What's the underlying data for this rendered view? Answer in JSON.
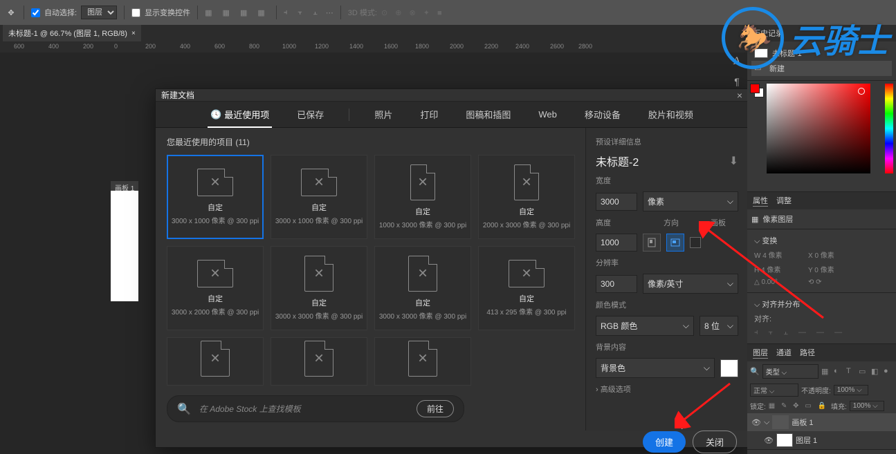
{
  "toolbar": {
    "auto_select": "自动选择:",
    "layer_dropdown": "图层",
    "show_transform": "显示变换控件",
    "mode_3d": "3D 模式:"
  },
  "doc_tab": {
    "title": "未标题-1 @ 66.7% (图层 1, RGB/8)"
  },
  "ruler_marks": [
    "600",
    "400",
    "200",
    "0",
    "200",
    "400",
    "600",
    "800",
    "1000",
    "1200",
    "1400",
    "1600",
    "1800",
    "2000",
    "2200",
    "2400",
    "2600",
    "2800"
  ],
  "artboard_label": "画板 1",
  "dialog": {
    "title": "新建文档",
    "tabs": {
      "recent": "最近使用项",
      "saved": "已保存",
      "photo": "照片",
      "print": "打印",
      "art": "图稿和插图",
      "web": "Web",
      "mobile": "移动设备",
      "film": "胶片和视频"
    },
    "recent_label": "您最近使用的项目 (11)",
    "presets": [
      {
        "name": "自定",
        "dim": "3000 x 1000 像素 @ 300 ppi",
        "shape": "wide"
      },
      {
        "name": "自定",
        "dim": "3000 x 1000 像素 @ 300 ppi",
        "shape": "wide"
      },
      {
        "name": "自定",
        "dim": "1000 x 3000 像素 @ 300 ppi",
        "shape": "tall"
      },
      {
        "name": "自定",
        "dim": "2000 x 3000 像素 @ 300 ppi",
        "shape": "tall"
      },
      {
        "name": "自定",
        "dim": "3000 x 2000 像素 @ 300 ppi",
        "shape": "wide"
      },
      {
        "name": "自定",
        "dim": "3000 x 3000 像素 @ 300 ppi",
        "shape": ""
      },
      {
        "name": "自定",
        "dim": "3000 x 3000 像素 @ 300 ppi",
        "shape": ""
      },
      {
        "name": "自定",
        "dim": "413 x 295 像素 @ 300 ppi",
        "shape": "wide"
      },
      {
        "name": "",
        "dim": "",
        "shape": ""
      },
      {
        "name": "",
        "dim": "",
        "shape": ""
      },
      {
        "name": "",
        "dim": "",
        "shape": ""
      }
    ],
    "stock_placeholder": "在 Adobe Stock 上查找模板",
    "go_btn": "前往",
    "settings": {
      "section": "预设详细信息",
      "name": "未标题-2",
      "width_label": "宽度",
      "width": "3000",
      "width_unit": "像素",
      "height_label": "高度",
      "orient_label": "方向",
      "artboard_label": "画板",
      "height": "1000",
      "res_label": "分辨率",
      "res": "300",
      "res_unit": "像素/英寸",
      "color_label": "颜色模式",
      "color_mode": "RGB 颜色",
      "bit_depth": "8 位",
      "bg_label": "背景内容",
      "bg": "背景色",
      "advanced": "高级选项"
    },
    "create_btn": "创建",
    "close_btn": "关闭"
  },
  "panels": {
    "history": {
      "title": "历史记录",
      "item1": "未标题-1",
      "item2": "新建"
    },
    "props_tab": "属性",
    "adjust_tab": "调整",
    "pixel_layer": "像素图层",
    "transform": "变换",
    "transform_w": "W 4 像素",
    "transform_x": "X 0 像素",
    "transform_h": "H 4 像素",
    "transform_y": "Y 0 像素",
    "transform_angle": "0.00°",
    "align": "对齐并分布",
    "align_label": "对齐:",
    "layers_tab": "图层",
    "channels_tab": "通道",
    "paths_tab": "路径",
    "kind": "类型",
    "blend": "正常",
    "opacity_label": "不透明度:",
    "opacity": "100%",
    "lock_label": "锁定:",
    "fill_label": "填充:",
    "fill": "100%",
    "artboard1": "画板 1",
    "layer1": "图层 1"
  },
  "watermark": "云骑士"
}
